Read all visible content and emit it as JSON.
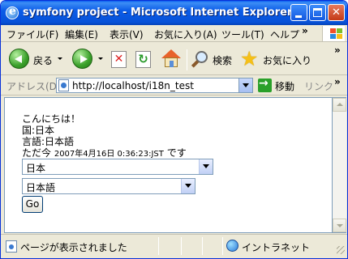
{
  "window": {
    "title": "symfony project - Microsoft Internet Explorer",
    "min_glyph": "",
    "max_glyph": "",
    "close_glyph": "✕"
  },
  "menu": {
    "items": [
      "ファイル(F)",
      "編集(E)",
      "表示(V)",
      "お気に入り(A)",
      "ツール(T)",
      "ヘルプ"
    ],
    "more": "»"
  },
  "toolbar": {
    "back_label": "戻る",
    "stop_glyph": "✕",
    "refresh_glyph": "↻",
    "search_label": "検索",
    "favorites_label": "お気に入り",
    "star_glyph": "★",
    "more": "»"
  },
  "address": {
    "label": "アドレス(D)",
    "url": "http://localhost/i18n_test",
    "go_label": "移動",
    "links_label": "リンク",
    "more": "»"
  },
  "page": {
    "greeting": "こんにちは！",
    "country_line": "国:日本",
    "language_line": "言語:日本語",
    "time_prefix": "ただ今 ",
    "time_value": "2007年4月16日 0:36:23:JST",
    "time_suffix": " です",
    "country_select_value": "日本",
    "language_select_value": "日本語",
    "go_button": "Go"
  },
  "status": {
    "text": "ページが表示されました",
    "zone": "イントラネット"
  },
  "icons": {
    "ie_logo": "ie-logo-icon",
    "back": "back-arrow-icon",
    "forward": "forward-arrow-icon",
    "stop": "stop-icon",
    "refresh": "refresh-icon",
    "home": "home-icon",
    "search": "search-icon",
    "favorites": "star-icon",
    "go": "go-arrow-icon",
    "page": "page-icon",
    "zone": "globe-icon"
  }
}
